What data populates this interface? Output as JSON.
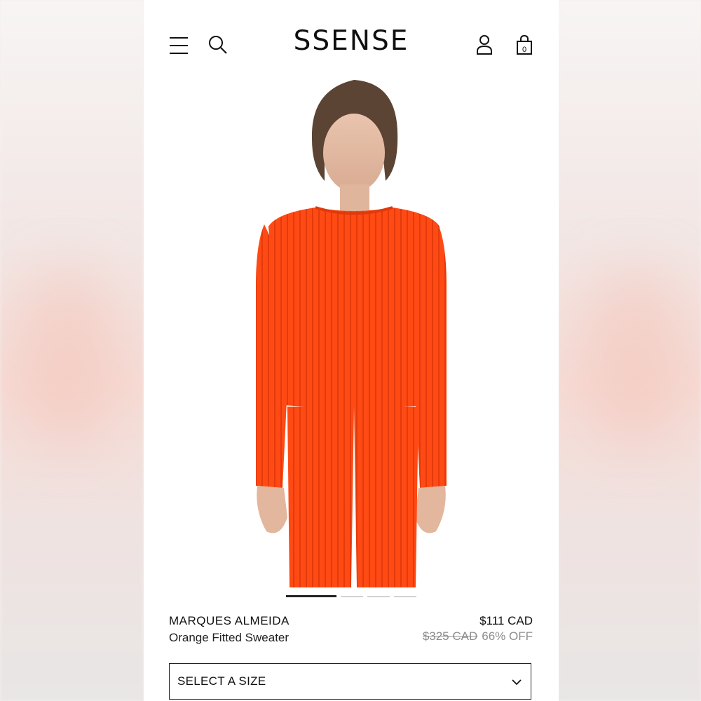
{
  "header": {
    "logo": "SSENSE",
    "icons": [
      "hamburger-menu-icon",
      "search-icon",
      "account-icon",
      "shopping-bag-icon"
    ],
    "bag_count": "0"
  },
  "gallery": {
    "image_alt": "Model wearing orange ribbed fitted sweater and matching pants",
    "current_slide": 1,
    "slide_count": 4
  },
  "product": {
    "brand": "MARQUES ALMEIDA",
    "name": "Orange Fitted Sweater",
    "price": "$111 CAD",
    "original_price": "$325 CAD",
    "discount": "66% OFF"
  },
  "size_select": {
    "label": "SELECT A SIZE"
  },
  "colors": {
    "garment": "#ff4a14",
    "text": "#111111",
    "muted": "#8c8c8c"
  }
}
